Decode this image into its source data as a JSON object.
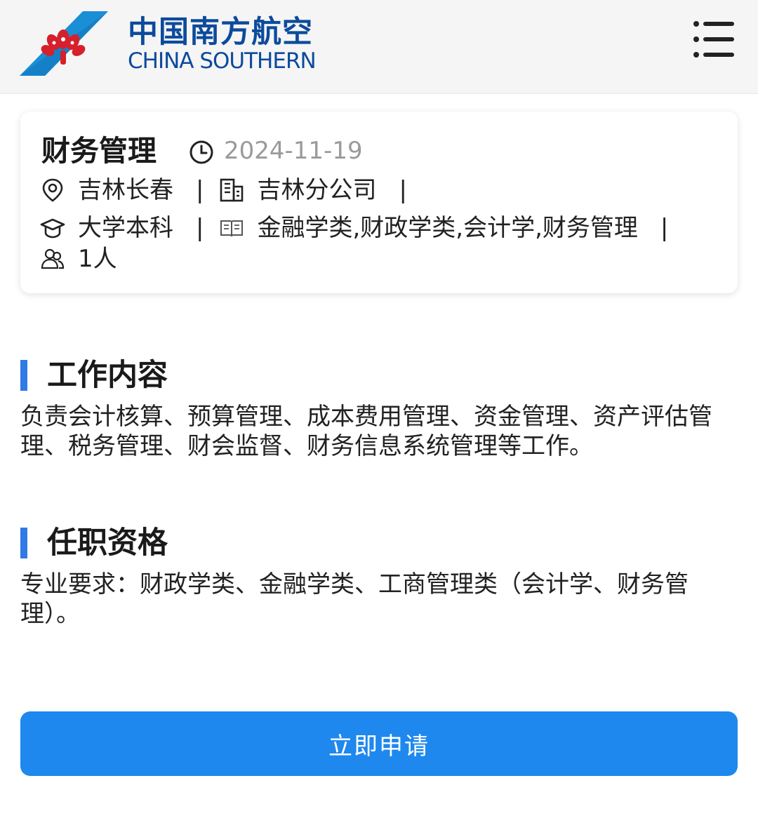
{
  "header": {
    "logo_cn": "中国南方航空",
    "logo_en": "CHINA SOUTHERN",
    "menu_icon": "menu-list-icon",
    "brand_color": "#0c4b9c",
    "logo_red": "#d6202c",
    "logo_blue": "#1a8fd6"
  },
  "job": {
    "title": "财务管理",
    "date": "2024-11-19",
    "location": "吉林长春",
    "company": "吉林分公司",
    "education": "大学本科",
    "majors": "金融学类,财政学类,会计学,财务管理",
    "headcount": "1人",
    "separator": "|"
  },
  "sections": {
    "content": {
      "title": "工作内容",
      "body": "负责会计核算、预算管理、成本费用管理、资金管理、资产评估管理、税务管理、财会监督、财务信息系统管理等工作。"
    },
    "requirements": {
      "title": "任职资格",
      "body": "专业要求：财政学类、金融学类、工商管理类（会计学、财务管理）。"
    }
  },
  "apply_button": {
    "label": "立即申请",
    "color": "#1e88ee"
  }
}
